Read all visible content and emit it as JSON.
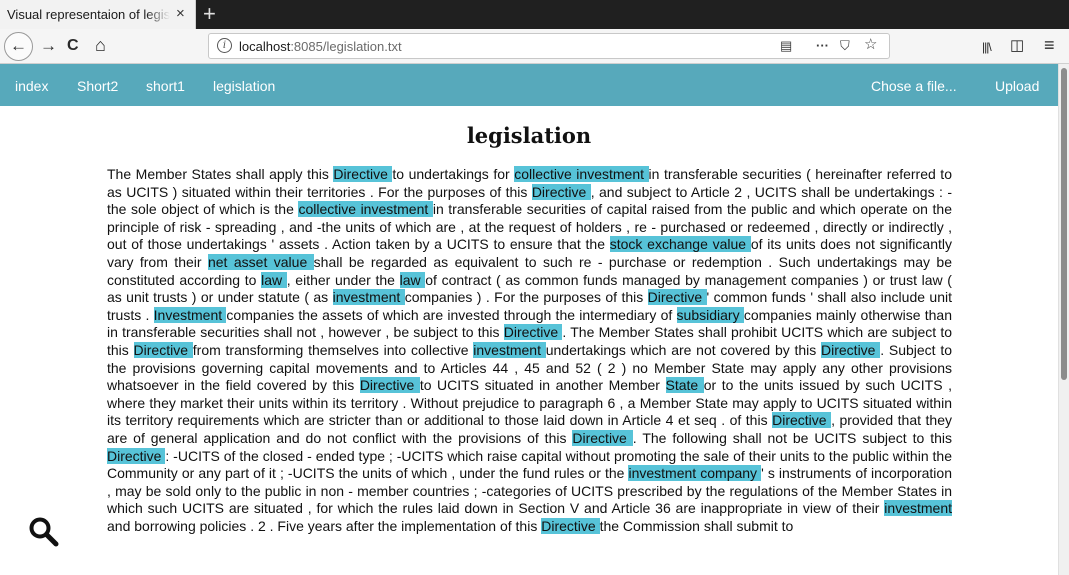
{
  "browser": {
    "tab_title": "Visual representaion of legislation",
    "tab_close": "×",
    "new_tab": "+",
    "back_icon": "←",
    "forward_icon": "→",
    "reload_icon": "C",
    "home_icon": "⌂",
    "url_host": "localhost",
    "url_rest": ":8085/legislation.txt",
    "reader_icon": "▤",
    "more_icon": "···",
    "pocket_icon": "⛉",
    "bookmark_icon": "☆",
    "library_icon": "|||\\",
    "sidebar_icon": "◫",
    "menu_icon": "≡"
  },
  "app_nav": {
    "links": [
      "index",
      "Short2",
      "short1",
      "legislation"
    ],
    "file_label": "Chose a file...",
    "upload_label": "Upload"
  },
  "page": {
    "title": "legislation"
  },
  "document_segments": [
    {
      "t": "The Member States shall apply this ",
      "h": false
    },
    {
      "t": "Directive ",
      "h": true
    },
    {
      "t": "to undertakings for ",
      "h": false
    },
    {
      "t": "collective investment ",
      "h": true
    },
    {
      "t": "in transferable securities ( hereinafter referred to as UCITS ) situated within their territories . For the purposes of this ",
      "h": false
    },
    {
      "t": "Directive ",
      "h": true
    },
    {
      "t": ", and subject to Article 2 , UCITS shall be undertakings : -the sole object of which is the ",
      "h": false
    },
    {
      "t": "collective investment ",
      "h": true
    },
    {
      "t": "in transferable securities of capital raised from the public and which operate on the principle of risk - spreading , and -the units of which are , at the request of holders , re - purchased or redeemed , directly or indirectly , out of those undertakings ' assets . Action taken by a UCITS to ensure that the ",
      "h": false
    },
    {
      "t": "stock exchange value ",
      "h": true
    },
    {
      "t": "of its units does not significantly vary from their ",
      "h": false
    },
    {
      "t": "net asset value ",
      "h": true
    },
    {
      "t": "shall be regarded as equivalent to such re - purchase or redemption . Such undertakings may be constituted according to ",
      "h": false
    },
    {
      "t": "law ",
      "h": true
    },
    {
      "t": ", either under the ",
      "h": false
    },
    {
      "t": "law ",
      "h": true
    },
    {
      "t": "of contract ( as common funds managed by management companies ) or trust law ( as unit trusts ) or under statute ( as ",
      "h": false
    },
    {
      "t": "investment ",
      "h": true
    },
    {
      "t": "companies ) . For the purposes of this ",
      "h": false
    },
    {
      "t": "Directive ",
      "h": true
    },
    {
      "t": "' common funds ' shall also include unit trusts . ",
      "h": false
    },
    {
      "t": "Investment ",
      "h": true
    },
    {
      "t": "companies the assets of which are invested through the intermediary of ",
      "h": false
    },
    {
      "t": "subsidiary ",
      "h": true
    },
    {
      "t": "companies mainly otherwise than in transferable securities shall not , however , be subject to this ",
      "h": false
    },
    {
      "t": "Directive ",
      "h": true
    },
    {
      "t": ". The Member States shall prohibit UCITS which are subject to this ",
      "h": false
    },
    {
      "t": "Directive ",
      "h": true
    },
    {
      "t": "from transforming themselves into collective ",
      "h": false
    },
    {
      "t": "investment ",
      "h": true
    },
    {
      "t": "undertakings which are not covered by this ",
      "h": false
    },
    {
      "t": "Directive ",
      "h": true
    },
    {
      "t": ". Subject to the provisions governing capital movements and to Articles 44 , 45 and 52 ( 2 ) no Member State may apply any other provisions whatsoever in the field covered by this ",
      "h": false
    },
    {
      "t": "Directive ",
      "h": true
    },
    {
      "t": "to UCITS situated in another Member ",
      "h": false
    },
    {
      "t": "State ",
      "h": true
    },
    {
      "t": "or to the units issued by such UCITS , where they market their units within its territory . Without prejudice to paragraph 6 , a Member State may apply to UCITS situated within its territory requirements which are stricter than or additional to those laid down in Article 4 et seq . of this ",
      "h": false
    },
    {
      "t": "Directive ",
      "h": true
    },
    {
      "t": ", provided that they are of general application and do not conflict with the provisions of this ",
      "h": false
    },
    {
      "t": "Directive ",
      "h": true
    },
    {
      "t": ". The following shall not be UCITS subject to this ",
      "h": false
    },
    {
      "t": "Directive ",
      "h": true
    },
    {
      "t": ": -UCITS of the closed - ended type ; -UCITS which raise capital without promoting the sale of their units to the public within the Community or any part of it ; -UCITS the units of which , under the fund rules or the ",
      "h": false
    },
    {
      "t": "investment company ",
      "h": true
    },
    {
      "t": "' s instruments of incorporation , may be sold only to the public in non - member countries ; -categories of UCITS prescribed by the regulations of the Member States in which such UCITS are situated , for which the rules laid down in Section V and Article 36 are inappropriate in view of their ",
      "h": false
    },
    {
      "t": "investment ",
      "h": true
    },
    {
      "t": "and borrowing policies . 2 . Five years after the implementation of this ",
      "h": false
    },
    {
      "t": "Directive ",
      "h": true
    },
    {
      "t": "the Commission shall submit to",
      "h": false
    }
  ],
  "colors": {
    "nav_bg": "#57a9bb",
    "highlight": "#57c3d8"
  }
}
